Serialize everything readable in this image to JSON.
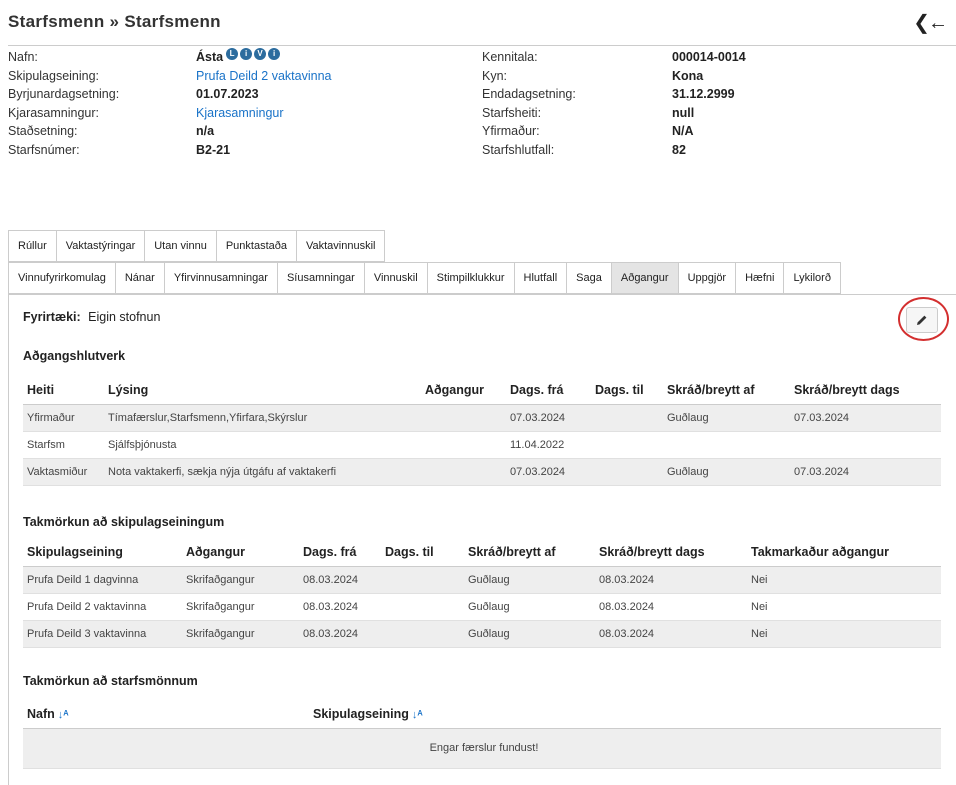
{
  "page": {
    "title": "Starfsmenn » Starfsmenn",
    "back_icon": "double-chevron-left-arrow-icon"
  },
  "info": {
    "left": [
      {
        "label": "Nafn:",
        "value": "Ásta",
        "badges": [
          "L",
          "i",
          "V",
          "i"
        ]
      },
      {
        "label": "Skipulagseining:",
        "value": "Prufa Deild 2 vaktavinna",
        "link": true
      },
      {
        "label": "Byrjunardagsetning:",
        "value": "01.07.2023"
      },
      {
        "label": "Kjarasamningur:",
        "value": "Kjarasamningur",
        "link": true
      },
      {
        "label": "Staðsetning:",
        "value": "n/a"
      },
      {
        "label": "Starfsnúmer:",
        "value": "B2-21"
      }
    ],
    "right": [
      {
        "label": "Kennitala:",
        "value": "000014-0014"
      },
      {
        "label": "Kyn:",
        "value": "Kona"
      },
      {
        "label": "Endadagsetning:",
        "value": "31.12.2999"
      },
      {
        "label": "Starfsheiti:",
        "value": "null"
      },
      {
        "label": "Yfirmaður:",
        "value": "N/A"
      },
      {
        "label": "Starfshlutfall:",
        "value": "82"
      }
    ]
  },
  "tabs_row1": [
    "Rúllur",
    "Vaktastýringar",
    "Utan vinnu",
    "Punktastaða",
    "Vaktavinnuskil"
  ],
  "tabs_row2": [
    "Vinnufyrirkomulag",
    "Nánar",
    "Yfirvinnusamningar",
    "Síusamningar",
    "Vinnuskil",
    "Stimpilklukkur",
    "Hlutfall",
    "Saga",
    "Aðgangur",
    "Uppgjör",
    "Hæfni",
    "Lykilorð"
  ],
  "active_tab": "Aðgangur",
  "panel": {
    "company_label": "Fyrirtæki:",
    "company_value": "Eigin stofnun",
    "edit_icon": "pencil-icon",
    "roles": {
      "title": "Aðgangshlutverk",
      "headers": [
        "Heiti",
        "Lýsing",
        "Aðgangur",
        "Dags. frá",
        "Dags. til",
        "Skráð/breytt af",
        "Skráð/breytt dags"
      ],
      "rows": [
        [
          "Yfirmaður",
          "Tímafærslur,Starfsmenn,Yfirfara,Skýrslur",
          "",
          "07.03.2024",
          "",
          "Guðlaug",
          "07.03.2024"
        ],
        [
          "Starfsm",
          "Sjálfsþjónusta",
          "",
          "11.04.2022",
          "",
          "",
          ""
        ],
        [
          "Vaktasmiður",
          "Nota vaktakerfi, sækja nýja útgáfu af vaktakerfi",
          "",
          "07.03.2024",
          "",
          "Guðlaug",
          "07.03.2024"
        ]
      ]
    },
    "units": {
      "title": "Takmörkun að skipulagseiningum",
      "headers": [
        "Skipulagseining",
        "Aðgangur",
        "Dags. frá",
        "Dags. til",
        "Skráð/breytt af",
        "Skráð/breytt dags",
        "Takmarkaður aðgangur"
      ],
      "rows": [
        [
          "Prufa Deild 1 dagvinna",
          "Skrifaðgangur",
          "08.03.2024",
          "",
          "Guðlaug",
          "08.03.2024",
          "Nei"
        ],
        [
          "Prufa Deild 2 vaktavinna",
          "Skrifaðgangur",
          "08.03.2024",
          "",
          "Guðlaug",
          "08.03.2024",
          "Nei"
        ],
        [
          "Prufa Deild 3 vaktavinna",
          "Skrifaðgangur",
          "08.03.2024",
          "",
          "Guðlaug",
          "08.03.2024",
          "Nei"
        ]
      ]
    },
    "employees": {
      "title": "Takmörkun að starfsmönnum",
      "headers": [
        "Nafn",
        "Skipulagseining"
      ],
      "sort_icon": "sort-alpha-icon",
      "empty_text": "Engar færslur fundust!"
    }
  }
}
